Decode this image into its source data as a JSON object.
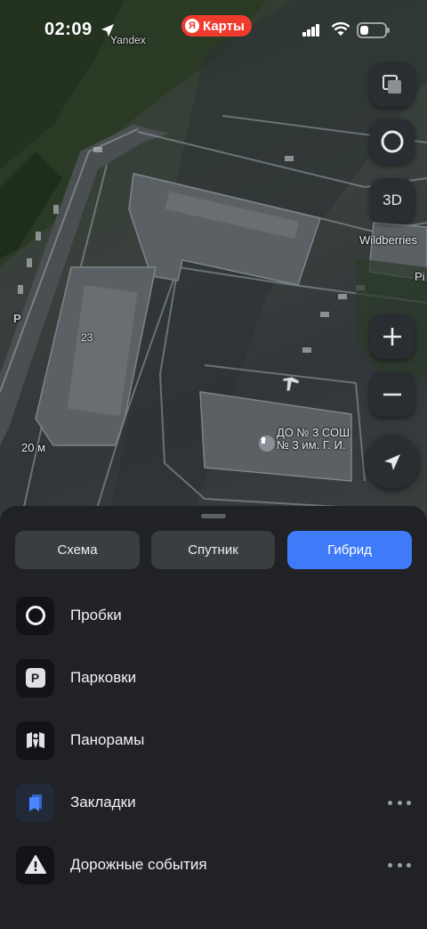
{
  "status_bar": {
    "time": "02:09",
    "app_badge_letter": "Я",
    "app_name": "Карты",
    "battery_level": 0.35
  },
  "map": {
    "watermark": "Yandex",
    "labels": {
      "house_number": "23",
      "scale": "20 м",
      "parking_marker": "P",
      "poi_shop": "Wildberries",
      "poi_shop_cut": "Pi",
      "poi_school": "ДО № 3 СОШ № 3 им. Г. И."
    },
    "controls": {
      "layers": "layers-icon",
      "traffic": "traffic-icon",
      "three_d_label": "3D",
      "zoom_in": "plus-icon",
      "zoom_out": "minus-icon",
      "locate": "navigation-arrow-icon"
    }
  },
  "sheet": {
    "map_types": [
      {
        "label": "Схема",
        "active": false
      },
      {
        "label": "Спутник",
        "active": false
      },
      {
        "label": "Гибрид",
        "active": true
      }
    ],
    "layers": [
      {
        "label": "Пробки",
        "icon": "traffic-ring-icon",
        "more": false
      },
      {
        "label": "Парковки",
        "icon": "parking-icon",
        "icon_text": "P",
        "more": false
      },
      {
        "label": "Панорамы",
        "icon": "panorama-icon",
        "more": false
      },
      {
        "label": "Закладки",
        "icon": "bookmarks-icon",
        "more": true
      },
      {
        "label": "Дорожные события",
        "icon": "road-events-warning-icon",
        "more": true
      }
    ]
  },
  "colors": {
    "accent": "#3f7bf8",
    "sheet_bg": "#202226",
    "brand_red": "#ef3b2d",
    "bookmark_blue": "#3f7bf8"
  }
}
